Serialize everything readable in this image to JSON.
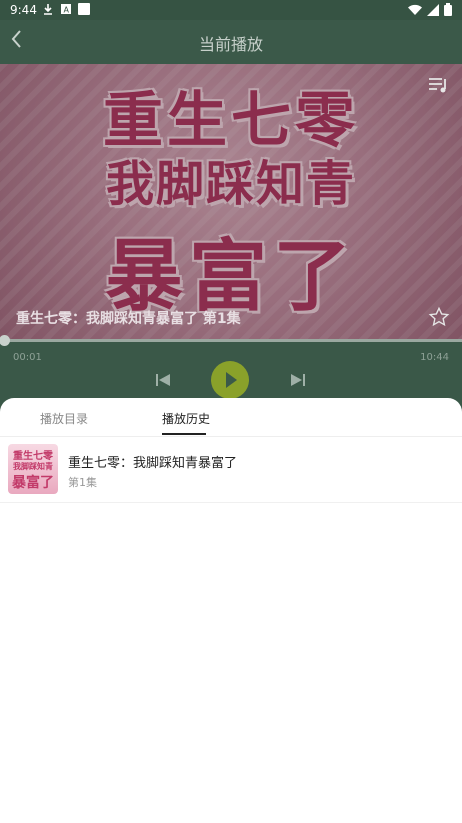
{
  "status_bar": {
    "time": "9:44",
    "left_icons": [
      "download-icon",
      "a-badge-icon",
      "square-icon"
    ],
    "right_icons": [
      "wifi-icon",
      "signal-icon",
      "battery-icon"
    ]
  },
  "header": {
    "back_icon": "chevron-left-icon",
    "title": "当前播放"
  },
  "cover": {
    "line1": "重生七零",
    "line2": "我脚踩知青",
    "line3": "暴富了",
    "episode_title": "重生七零：我脚踩知青暴富了 第1集",
    "playlist_icon": "playlist-icon",
    "favorite_icon": "star-outline-icon"
  },
  "player": {
    "current_time": "00:01",
    "total_time": "10:44",
    "progress_fraction": 0.0,
    "controls": [
      "skip-previous-icon",
      "play-icon",
      "skip-next-icon"
    ]
  },
  "sheet": {
    "tabs": [
      {
        "label": "播放目录",
        "active": false
      },
      {
        "label": "播放历史",
        "active": true
      }
    ],
    "history": [
      {
        "title": "重生七零：我脚踩知青暴富了",
        "episode": "第1集",
        "thumb_line1": "重生七零",
        "thumb_line2": "我脚踩知青",
        "thumb_line3": "暴富了"
      }
    ]
  },
  "colors": {
    "header_bg": "#3b5949",
    "accent_play": "#8aa12a",
    "sheet_bg": "#ffffff"
  }
}
